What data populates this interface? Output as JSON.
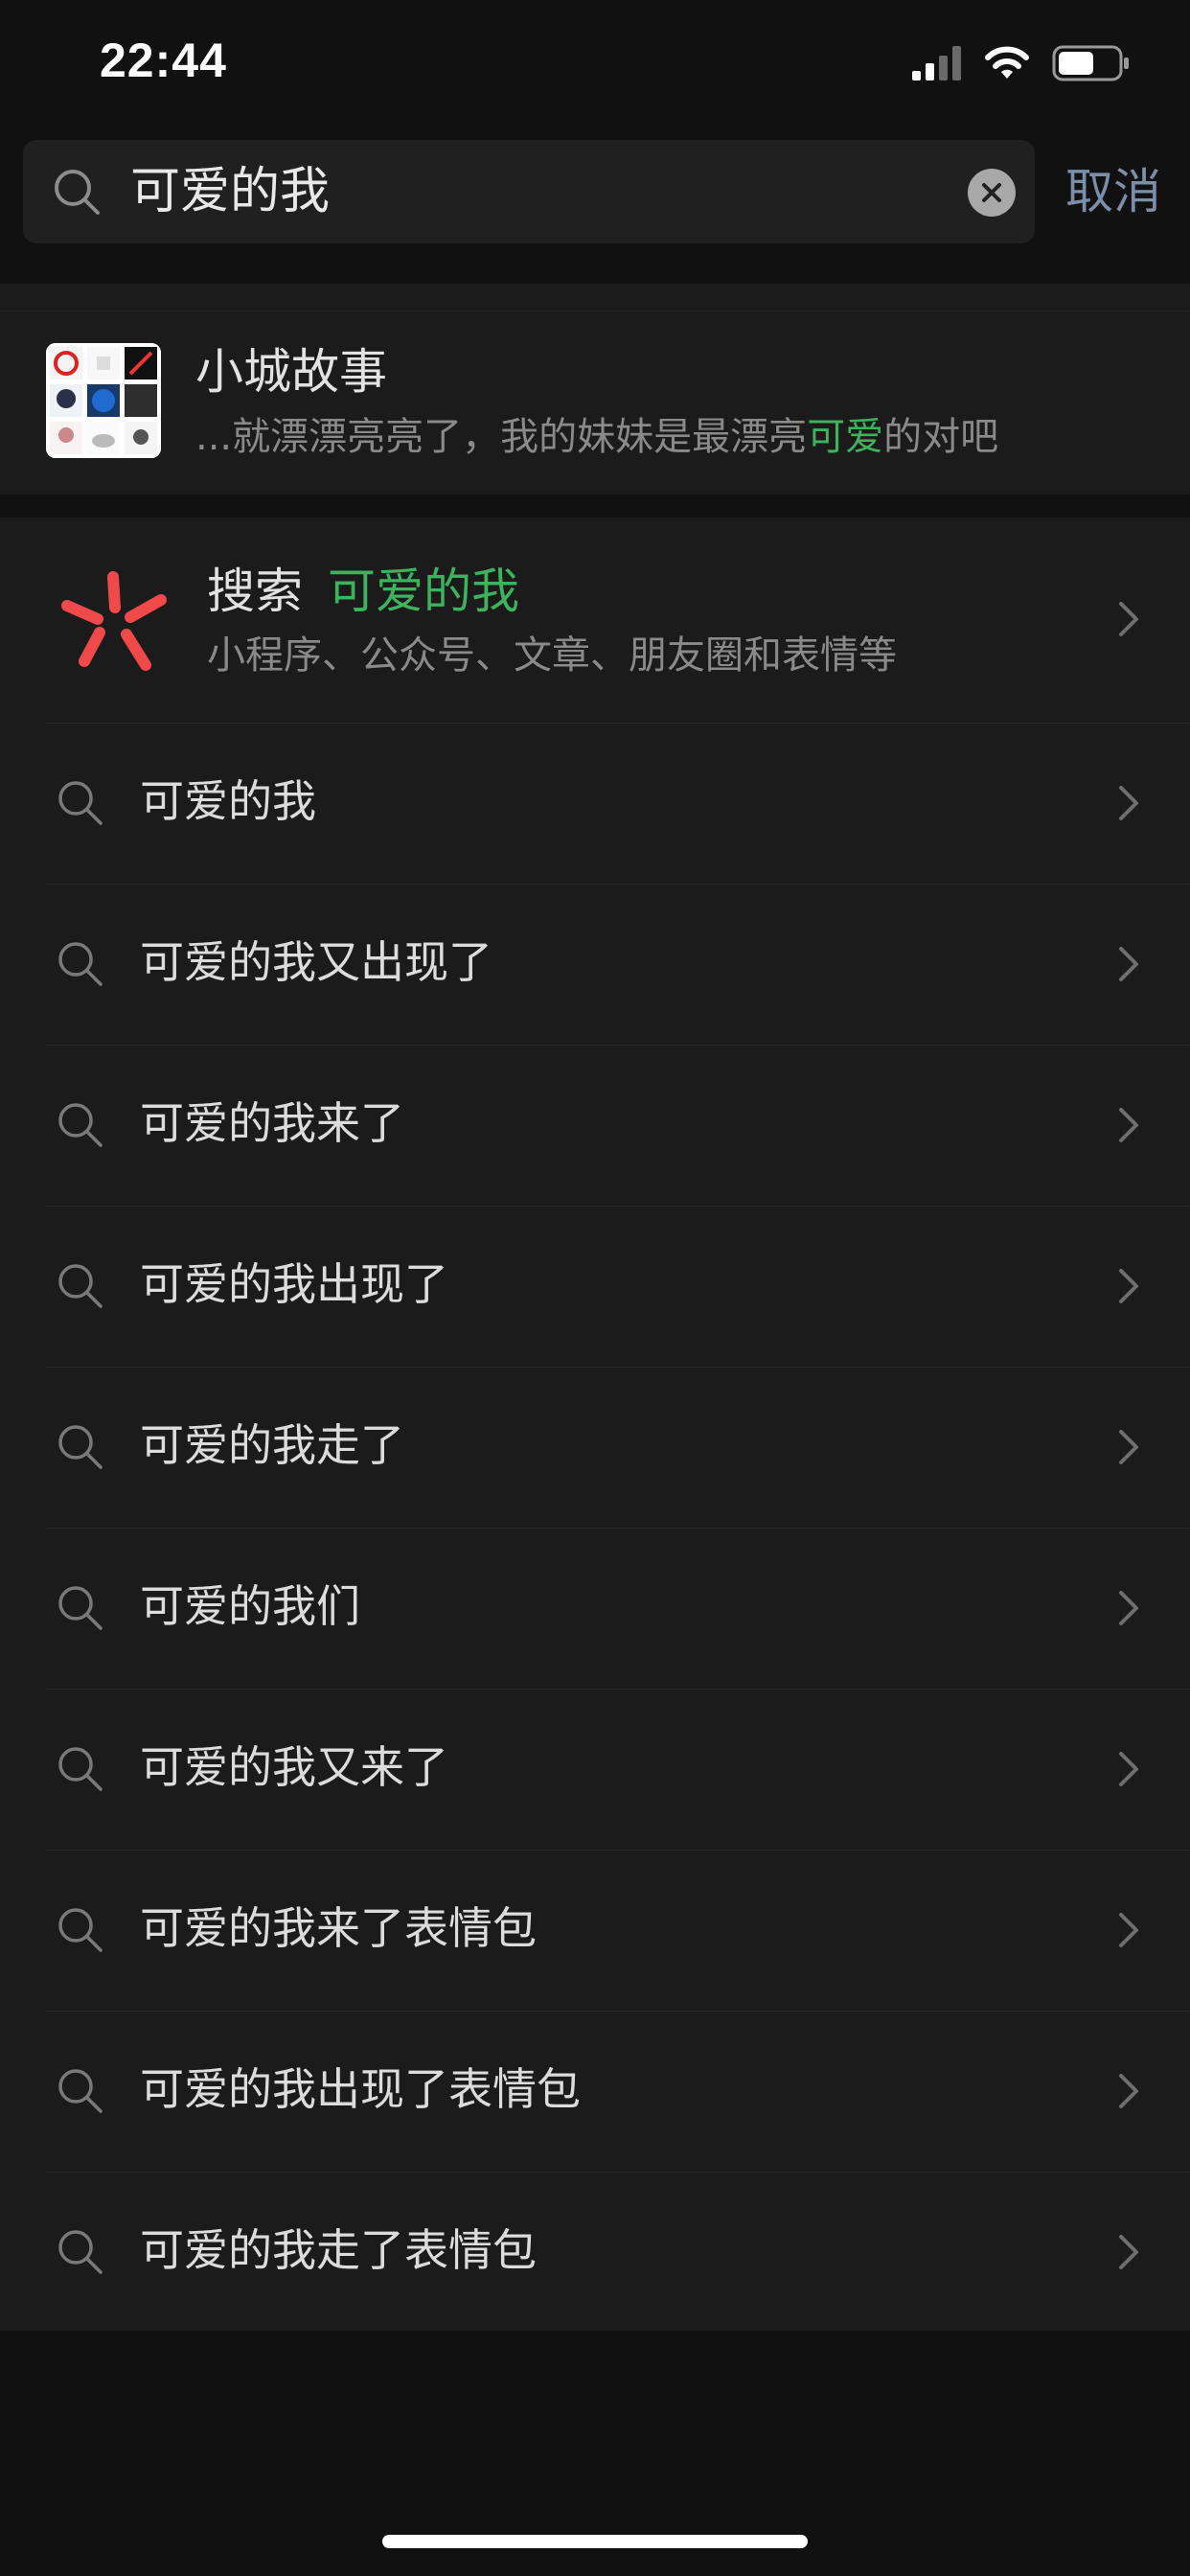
{
  "status_bar": {
    "time": "22:44",
    "signal_icon": "cellular-signal-icon",
    "wifi_icon": "wifi-icon",
    "battery_icon": "battery-icon",
    "battery_level": 0.5
  },
  "search": {
    "query": "可爱的我",
    "search_icon": "search-icon",
    "clear_icon": "clear-icon",
    "cancel_label": "取消"
  },
  "chat_result": {
    "name": "小城故事",
    "snippet_prefix": "...就漂漂亮亮了，我的妹妹是最漂亮",
    "snippet_highlight": "可爱",
    "snippet_suffix": "的对吧",
    "highlight_color": "#3db35e"
  },
  "web_search": {
    "label": "搜索",
    "keyword": "可爱的我",
    "subtitle": "小程序、公众号、文章、朋友圈和表情等",
    "icon": "search-flower-icon"
  },
  "suggestions": [
    "可爱的我",
    "可爱的我又出现了",
    "可爱的我来了",
    "可爱的我出现了",
    "可爱的我走了",
    "可爱的我们",
    "可爱的我又来了",
    "可爱的我来了表情包",
    "可爱的我出现了表情包",
    "可爱的我走了表情包"
  ]
}
